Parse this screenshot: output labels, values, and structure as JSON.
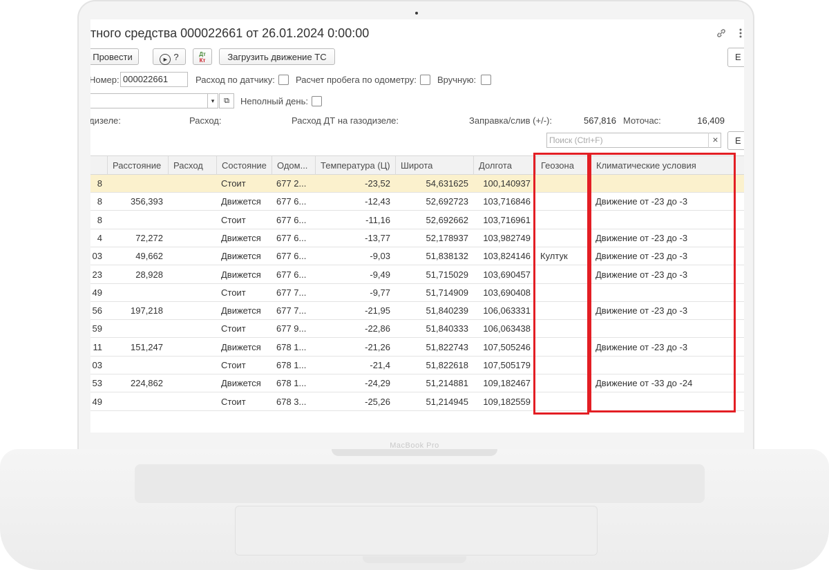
{
  "window": {
    "title": "тного средства 000022661 от 26.01.2024 0:00:00"
  },
  "toolbar": {
    "post_label": "Провести",
    "help_label": "?",
    "dt_label": "Дт",
    "kt_label": "Кт",
    "load_label": "Загрузить движение ТС",
    "right_label": "Е"
  },
  "form": {
    "number_label": "Номер:",
    "number_value": "000022661",
    "sensor_label": "Расход по датчику:",
    "odometer_label": "Расчет пробега по одометру:",
    "manual_label": "Вручную:",
    "partial_day_label": "Неполный день:",
    "diesel_label": "дизеле:",
    "consumption_label": "Расход:",
    "gas_diesel_label": "Расход ДТ на газодизеле:",
    "refuel_label": "Заправка/слив (+/-):",
    "refuel_value": "567,816",
    "motohours_label": "Моточас:",
    "motohours_value": "16,409",
    "search_placeholder": "Поиск (Ctrl+F)",
    "search_clear": "×",
    "right_button": "Е"
  },
  "icons": {
    "link": "link-icon",
    "more": "more-vertical-icon",
    "dropdown": "▾",
    "open": "⧉"
  },
  "table": {
    "columns": [
      "",
      "Расстояние",
      "Расход",
      "Состояние",
      "Одом...",
      "Температура (Ц)",
      "Широта",
      "Долгота",
      "Геозона",
      "Климатические условия"
    ],
    "rows": [
      [
        "8",
        "",
        "",
        "Стоит",
        "677 2...",
        "-23,52",
        "54,631625",
        "100,140937",
        "",
        ""
      ],
      [
        "8",
        "356,393",
        "",
        "Движется",
        "677 6...",
        "-12,43",
        "52,692723",
        "103,716846",
        "",
        "Движение от -23 до -3"
      ],
      [
        "8",
        "",
        "",
        "Стоит",
        "677 6...",
        "-11,16",
        "52,692662",
        "103,716961",
        "",
        ""
      ],
      [
        "4",
        "72,272",
        "",
        "Движется",
        "677 6...",
        "-13,77",
        "52,178937",
        "103,982749",
        "",
        "Движение от -23 до -3"
      ],
      [
        "03",
        "49,662",
        "",
        "Движется",
        "677 6...",
        "-9,03",
        "51,838132",
        "103,824146",
        "Култук",
        "Движение от -23 до -3"
      ],
      [
        "23",
        "28,928",
        "",
        "Движется",
        "677 6...",
        "-9,49",
        "51,715029",
        "103,690457",
        "",
        "Движение от -23 до -3"
      ],
      [
        "49",
        "",
        "",
        "Стоит",
        "677 7...",
        "-9,77",
        "51,714909",
        "103,690408",
        "",
        ""
      ],
      [
        "56",
        "197,218",
        "",
        "Движется",
        "677 7...",
        "-21,95",
        "51,840239",
        "106,063331",
        "",
        "Движение от -23 до -3"
      ],
      [
        "59",
        "",
        "",
        "Стоит",
        "677 9...",
        "-22,86",
        "51,840333",
        "106,063438",
        "",
        ""
      ],
      [
        "11",
        "151,247",
        "",
        "Движется",
        "678 1...",
        "-21,26",
        "51,822743",
        "107,505246",
        "",
        "Движение от -23 до -3"
      ],
      [
        "03",
        "",
        "",
        "Стоит",
        "678 1...",
        "-21,4",
        "51,822618",
        "107,505179",
        "",
        ""
      ],
      [
        "53",
        "224,862",
        "",
        "Движется",
        "678 1...",
        "-24,29",
        "51,214881",
        "109,182467",
        "",
        "Движение от -33 до -24"
      ],
      [
        "49",
        "",
        "",
        "Стоит",
        "678 3...",
        "-25,26",
        "51,214945",
        "109,182559",
        "",
        ""
      ]
    ]
  },
  "device": {
    "brand": "MacBook Pro"
  },
  "accent": {
    "highlight": "#e31e24",
    "selected_row": "#fbf1cd"
  }
}
